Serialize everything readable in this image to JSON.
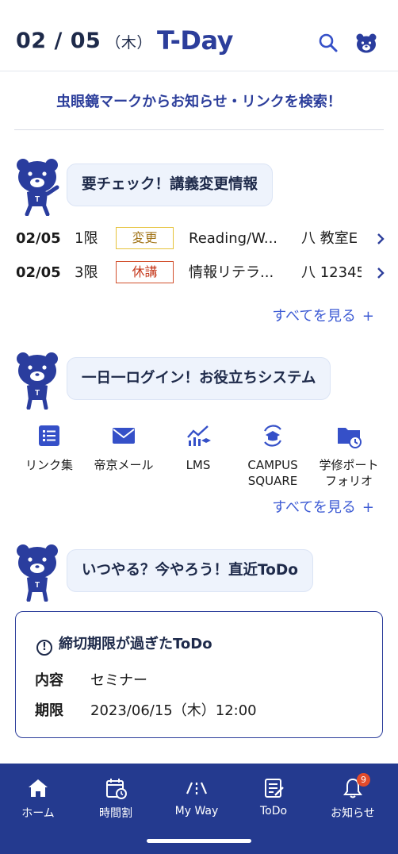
{
  "header": {
    "date": "02 / 05",
    "weekday": "（木）",
    "logo": "T-Day"
  },
  "search_hint": "虫眼鏡マークからお知らせ・リンクを検索！",
  "class_changes": {
    "heading": "要チェック！講義変更情報",
    "rows": [
      {
        "date": "02/05",
        "period": "1限",
        "badge": "変更",
        "subject": "Reading/W...",
        "room": "八 教室E"
      },
      {
        "date": "02/05",
        "period": "3限",
        "badge": "休講",
        "subject": "情報リテラ...",
        "room": "八 12345"
      }
    ],
    "see_all": "すべてを見る"
  },
  "systems": {
    "heading": "一日一ログイン！お役立ちシステム",
    "items": [
      {
        "label": "リンク集",
        "icon": "list-icon"
      },
      {
        "label": "帝京メール",
        "icon": "mail-icon"
      },
      {
        "label": "LMS",
        "icon": "lms-icon"
      },
      {
        "label": "CAMPUS\nSQUARE",
        "icon": "campus-square-icon"
      },
      {
        "label": "学修ポート\nフォリオ",
        "icon": "portfolio-folder-icon"
      }
    ],
    "see_all": "すべてを見る"
  },
  "todo": {
    "heading": "いつやる？今やろう！直近ToDo",
    "card_title": "締切期限が過ぎたToDo",
    "content_label": "内容",
    "content_value": "セミナー",
    "deadline_label": "期限",
    "deadline_value": "2023/06/15（木）12:00"
  },
  "tabbar": {
    "tabs": [
      {
        "label": "ホーム",
        "icon": "home-icon"
      },
      {
        "label": "時間割",
        "icon": "calendar-clock-icon"
      },
      {
        "label": "My Way",
        "icon": "myway-icon"
      },
      {
        "label": "ToDo",
        "icon": "todo-icon"
      },
      {
        "label": "お知らせ",
        "icon": "bell-icon"
      }
    ],
    "notification_count": "9"
  },
  "colors": {
    "brand": "#2c3e9b",
    "tabbar": "#243a8f",
    "link": "#3d5bd4",
    "badge_change": "#e6c23a",
    "badge_cancel": "#d2502d"
  }
}
